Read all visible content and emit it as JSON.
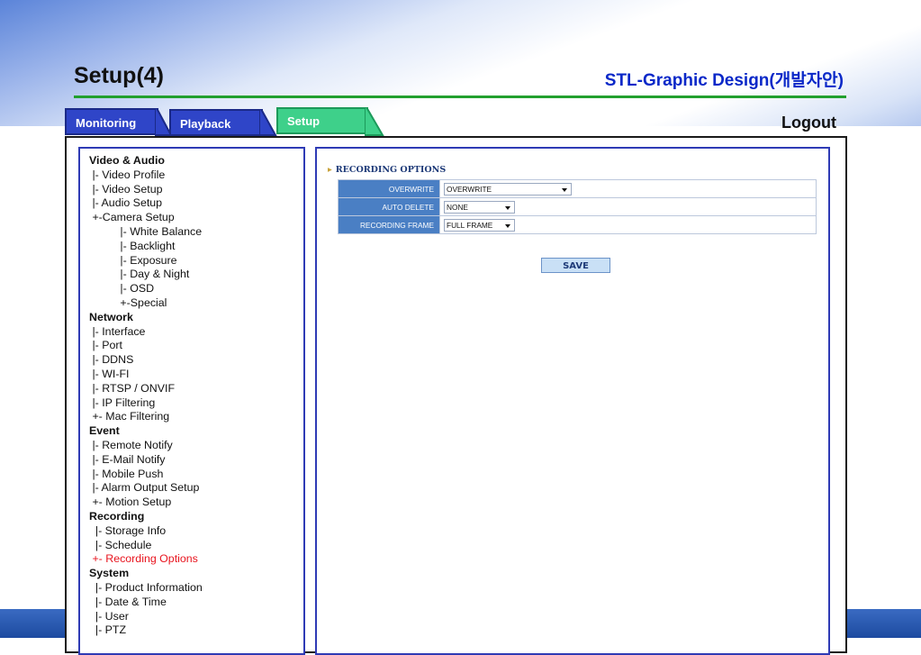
{
  "slide": {
    "title": "Setup(4)",
    "subtitle": "STL-Graphic Design(개발자안)"
  },
  "tabs": [
    {
      "label": "Monitoring",
      "active": false
    },
    {
      "label": "Playback",
      "active": false
    },
    {
      "label": "Setup",
      "active": true
    }
  ],
  "logout_label": "Logout",
  "menu": [
    {
      "text": "Video & Audio",
      "type": "section"
    },
    {
      "text": " |- Video Profile",
      "type": "item"
    },
    {
      "text": " |- Video Setup",
      "type": "item"
    },
    {
      "text": " |- Audio Setup",
      "type": "item"
    },
    {
      "text": " +-Camera Setup",
      "type": "item"
    },
    {
      "text": "          |- White Balance",
      "type": "item"
    },
    {
      "text": "          |- Backlight",
      "type": "item"
    },
    {
      "text": "          |- Exposure",
      "type": "item"
    },
    {
      "text": "          |- Day & Night",
      "type": "item"
    },
    {
      "text": "          |- OSD",
      "type": "item"
    },
    {
      "text": "          +-Special",
      "type": "item"
    },
    {
      "text": "Network",
      "type": "section"
    },
    {
      "text": " |- Interface",
      "type": "item"
    },
    {
      "text": " |- Port",
      "type": "item"
    },
    {
      "text": " |- DDNS",
      "type": "item"
    },
    {
      "text": " |- WI-FI",
      "type": "item"
    },
    {
      "text": " |- RTSP / ONVIF",
      "type": "item"
    },
    {
      "text": " |- IP Filtering",
      "type": "item"
    },
    {
      "text": " +- Mac Filtering",
      "type": "item"
    },
    {
      "text": "Event",
      "type": "section"
    },
    {
      "text": " |- Remote Notify",
      "type": "item"
    },
    {
      "text": " |- E-Mail Notify",
      "type": "item"
    },
    {
      "text": " |- Mobile Push",
      "type": "item"
    },
    {
      "text": " |- Alarm Output Setup",
      "type": "item"
    },
    {
      "text": " +- Motion Setup",
      "type": "item"
    },
    {
      "text": "Recording",
      "type": "section"
    },
    {
      "text": "  |- Storage Info",
      "type": "item"
    },
    {
      "text": "  |- Schedule",
      "type": "item"
    },
    {
      "text": " +- Recording Options",
      "type": "active"
    },
    {
      "text": "System",
      "type": "section"
    },
    {
      "text": "  |- Product Information",
      "type": "item"
    },
    {
      "text": "  |- Date & Time",
      "type": "item"
    },
    {
      "text": "  |- User",
      "type": "item"
    },
    {
      "text": "  |- PTZ",
      "type": "item"
    }
  ],
  "recording": {
    "title": "RECORDING OPTIONS",
    "options": [
      {
        "label": "OVERWRITE",
        "value": "OVERWRITE"
      },
      {
        "label": "AUTO DELETE",
        "value": "NONE"
      },
      {
        "label": "RECORDING FRAME",
        "value": "FULL FRAME"
      }
    ],
    "save_label": "SAVE"
  },
  "colors": {
    "tab_blue": "#2f45c8",
    "tab_green": "#3ed08a",
    "panel_border": "#2f3bb5",
    "label_cell": "#4a7fc4",
    "active_menu": "#e8141e",
    "subtitle_blue": "#0a28c8",
    "rule_green": "#22a02e"
  }
}
